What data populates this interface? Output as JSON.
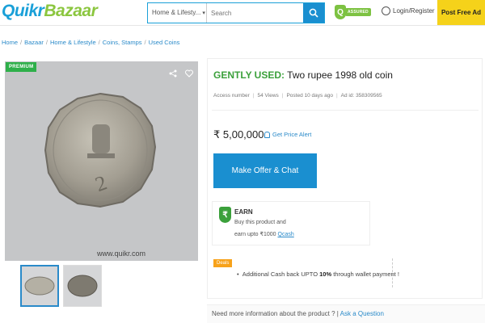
{
  "header": {
    "logo_quikr": "Quikr",
    "logo_bazaar": "Bazaar",
    "category_select": "Home & Lifesty...",
    "search_placeholder": "Search",
    "assured_label": "ASSURED",
    "assured_icon_letter": "Q",
    "login_label": "Login/Register",
    "post_ad_label": "Post Free Ad"
  },
  "breadcrumb": [
    "Home",
    "Bazaar",
    "Home & Lifestyle",
    "Coins, Stamps",
    "Used Coins"
  ],
  "gallery": {
    "badge": "PREMIUM",
    "watermark": "www.quikr.com",
    "thumbnail_count": 2
  },
  "product": {
    "condition": "GENTLY USED:",
    "title": "Two rupee 1998 old coin",
    "seller": "Access number",
    "views": "54 Views",
    "posted": "Posted 10 days ago",
    "ad_id": "Ad id: 358309565",
    "price": "₹ 5,00,000",
    "price_alert": "Get Price Alert",
    "offer_button": "Make Offer & Chat"
  },
  "earn": {
    "icon_symbol": "₹",
    "title": "EARN",
    "line1": "Buy this product and",
    "line2_prefix": "earn upto ₹1000",
    "line2_link": "Qcash"
  },
  "deals": {
    "tag": "Deals",
    "text_prefix": "Additional Cash back UPTO ",
    "text_bold": "10%",
    "text_suffix": " through wallet payment !"
  },
  "more_info": {
    "question": "Need more information about the product ?",
    "ask_link": "Ask a Question"
  },
  "colors": {
    "brand_blue": "#1a8fd0",
    "brand_green": "#3ba03b",
    "post_ad_yellow": "#f5d21a",
    "deals_orange": "#f7a21b"
  }
}
